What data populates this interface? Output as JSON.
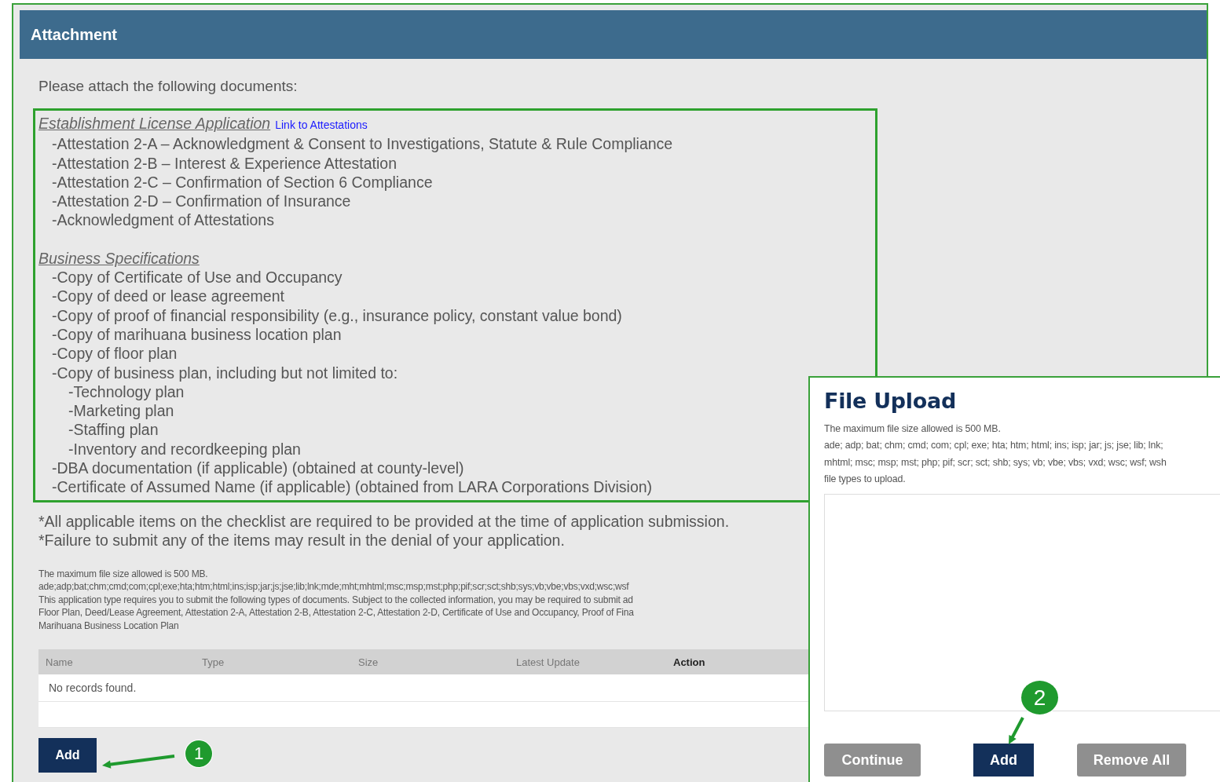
{
  "panel": {
    "title": "Attachment",
    "intro": "Please attach the following documents:",
    "sections": [
      {
        "heading": "Establishment License Application",
        "link": "Link to Attestations",
        "items": [
          {
            "text": "-Attestation 2-A – Acknowledgment & Consent to Investigations, Statute & Rule Compliance"
          },
          {
            "text": "-Attestation 2-B – Interest & Experience Attestation"
          },
          {
            "text": "-Attestation 2-C – Confirmation of Section 6 Compliance"
          },
          {
            "text": "-Attestation 2-D – Confirmation of Insurance"
          },
          {
            "text": "-Acknowledgment of Attestations"
          }
        ]
      },
      {
        "heading": "Business Specifications",
        "items": [
          {
            "text": "-Copy of Certificate of Use and Occupancy"
          },
          {
            "text": "-Copy of deed or lease agreement"
          },
          {
            "text": "-Copy of proof of financial responsibility (e.g., insurance policy, constant value bond)"
          },
          {
            "text": "-Copy of marihuana business location plan"
          },
          {
            "text": "-Copy of floor plan"
          },
          {
            "text": "-Copy of business plan, including but not limited to:",
            "children": [
              {
                "text": "-Technology plan"
              },
              {
                "text": "-Marketing plan"
              },
              {
                "text": "-Staffing plan"
              },
              {
                "text": "-Inventory and recordkeeping plan"
              }
            ]
          },
          {
            "text": "-DBA documentation (if applicable) (obtained at county-level)"
          },
          {
            "text": "-Certificate of Assumed Name (if applicable) (obtained from LARA Corporations Division)"
          }
        ]
      }
    ],
    "notes": [
      "*All applicable items on the checklist are required to be provided at the time of application submission.",
      "*Failure to submit any of the items may result in the denial of your application."
    ],
    "info_lines": [
      "The maximum file size allowed is 500 MB.",
      "ade;adp;bat;chm;cmd;com;cpl;exe;hta;htm;html;ins;isp;jar;js;jse;lib;lnk;mde;mht;mhtml;msc;msp;mst;php;pif;scr;sct;shb;sys;vb;vbe;vbs;vxd;wsc;wsf",
      "This application type requires you to submit the following types of documents. Subject to the collected information, you may be required to submit ad",
      "Floor Plan, Deed/Lease Agreement, Attestation 2-A, Attestation 2-B, Attestation 2-C, Attestation 2-D, Certificate of Use and Occupancy, Proof of Fina",
      "Marihuana Business Location Plan"
    ],
    "table": {
      "columns": [
        "Name",
        "Type",
        "Size",
        "Latest Update",
        "Action"
      ],
      "empty_message": "No records found."
    },
    "add_button": "Add"
  },
  "dialog": {
    "title": "File Upload",
    "info_lines": [
      "The maximum file size allowed is 500 MB.",
      "ade; adp; bat; chm; cmd; com; cpl; exe; hta; htm; html; ins; isp; jar; js; jse; lib; lnk;",
      "mhtml; msc; msp; mst; php; pif; scr; sct; shb; sys; vb; vbe; vbs; vxd; wsc; wsf; wsh",
      "file types to upload."
    ],
    "buttons": [
      {
        "label": "Continue",
        "disabled": true
      },
      {
        "label": "Add",
        "disabled": false
      },
      {
        "label": "Remove All",
        "disabled": true
      }
    ]
  },
  "callouts": [
    {
      "label": "1"
    },
    {
      "label": "2"
    }
  ]
}
